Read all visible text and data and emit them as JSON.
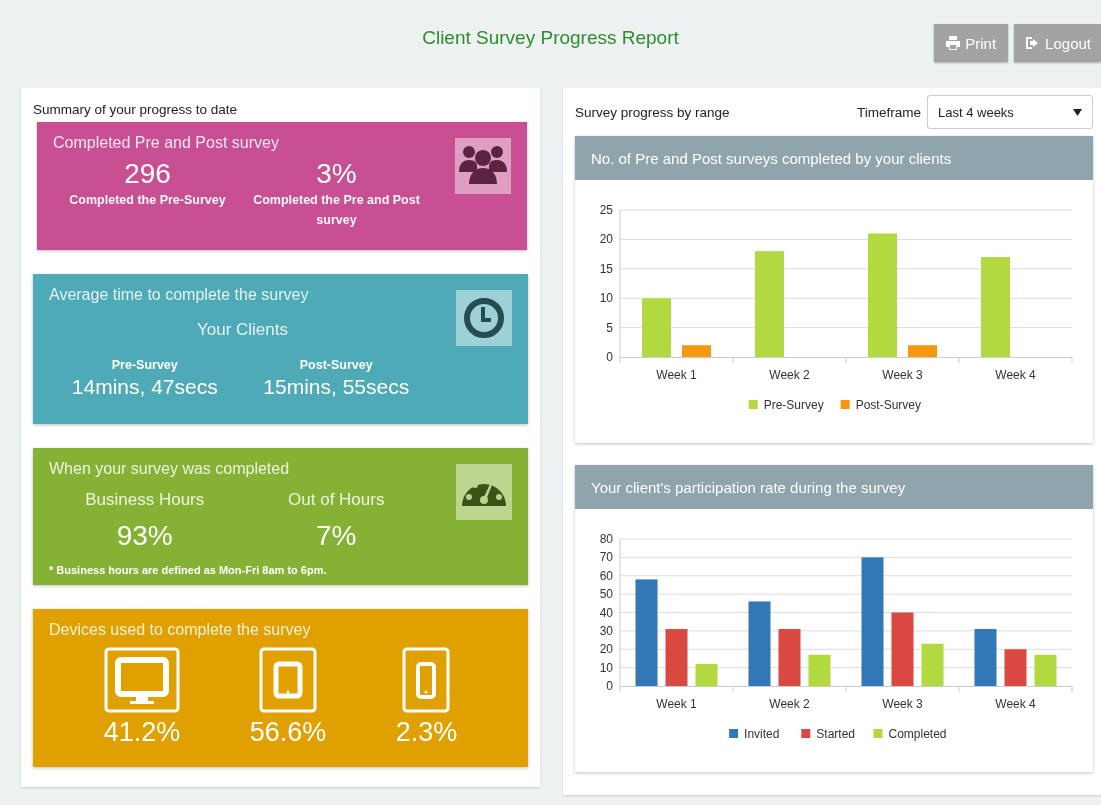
{
  "header": {
    "title": "Client Survey Progress Report",
    "buttons": [
      {
        "label": "Print"
      },
      {
        "label": "Logout"
      }
    ]
  },
  "summary": {
    "heading": "Summary of your progress to date",
    "cards": [
      {
        "kind": "value_first",
        "color": "#c94f93",
        "title": "Completed Pre and Post survey",
        "items": [
          {
            "value": "296",
            "label": "Completed the Pre-Survey"
          },
          {
            "value": "3%",
            "label": "Completed the Pre and Post survey"
          }
        ]
      },
      {
        "kind": "label_first",
        "color": "#4eaab6",
        "title": "Average time to complete the survey",
        "subtitle": "Your Clients",
        "items": [
          {
            "label": "Pre-Survey",
            "value": "14mins, 47secs"
          },
          {
            "label": "Post-Survey",
            "value": "15mins, 55secs"
          }
        ]
      },
      {
        "kind": "big_label_first",
        "color": "#85b234",
        "title": "When your survey was completed",
        "items": [
          {
            "label": "Business Hours",
            "value": "93%"
          },
          {
            "label": "Out of Hours",
            "value": "7%"
          }
        ],
        "note": "* Business hours are defined as Mon-Fri 8am to 6pm."
      },
      {
        "kind": "devices",
        "color": "#e0a000",
        "title": "Devices used to complete the survey",
        "items": [
          {
            "kind": "desktop",
            "value": "41.2%"
          },
          {
            "kind": "tablet",
            "value": "56.6%"
          },
          {
            "kind": "phone",
            "value": "2.3%"
          }
        ]
      }
    ]
  },
  "progress": {
    "heading": "Survey progress by range",
    "timeframe": {
      "label": "Timeframe",
      "value": "Last 4 weeks"
    },
    "charts": [
      {
        "title": "No. of Pre and Post surveys completed by your clients",
        "chart_data": {
          "type": "bar",
          "categories": [
            "Week 1",
            "Week 2",
            "Week 3",
            "Week 4"
          ],
          "series": [
            {
              "name": "Pre-Survey",
              "color": "#b2d93f",
              "values": [
                10,
                18,
                21,
                17
              ]
            },
            {
              "name": "Post-Survey",
              "color": "#f7960f",
              "values": [
                2,
                0,
                2,
                0
              ]
            }
          ],
          "ylim": [
            0,
            25
          ],
          "yticks": [
            0,
            5,
            10,
            15,
            20,
            25
          ],
          "grid": true,
          "legend": "bottom"
        }
      },
      {
        "title": "Your client's participation rate during the survey",
        "chart_data": {
          "type": "bar",
          "categories": [
            "Week 1",
            "Week 2",
            "Week 3",
            "Week 4"
          ],
          "series": [
            {
              "name": "Invited",
              "color": "#3277b6",
              "values": [
                58,
                46,
                70,
                31
              ]
            },
            {
              "name": "Started",
              "color": "#d94841",
              "values": [
                31,
                31,
                40,
                20
              ]
            },
            {
              "name": "Completed",
              "color": "#b2d93f",
              "values": [
                12,
                17,
                23,
                17
              ]
            }
          ],
          "ylim": [
            0,
            80
          ],
          "yticks": [
            0,
            10,
            20,
            30,
            40,
            50,
            60,
            70,
            80
          ],
          "grid": true,
          "legend": "bottom"
        }
      }
    ]
  }
}
